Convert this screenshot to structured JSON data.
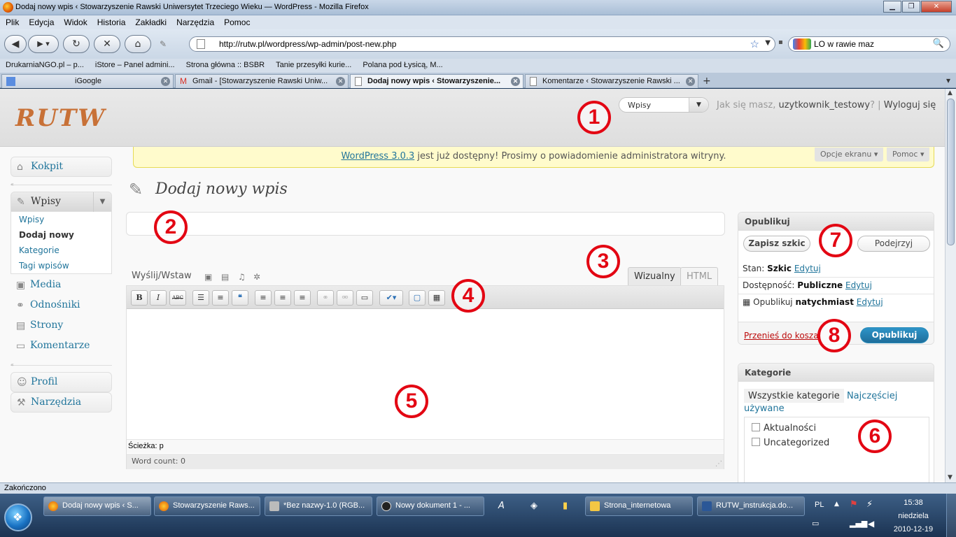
{
  "window": {
    "title": "Dodaj nowy wpis ‹ Stowarzyszenie Rawski Uniwersytet Trzeciego Wieku — WordPress - Mozilla Firefox"
  },
  "menubar": [
    "Plik",
    "Edycja",
    "Widok",
    "Historia",
    "Zakładki",
    "Narzędzia",
    "Pomoc"
  ],
  "navbar": {
    "url": "http://rutw.pl/wordpress/wp-admin/post-new.php",
    "search_value": "LO w rawie maz"
  },
  "bookmarks": [
    "DrukarniaNGO.pl – p...",
    "iStore – Panel admini...",
    "Strona główna :: BSBR",
    "Tanie przesyłki kurie...",
    "Polana pod Łysicą, M..."
  ],
  "tabs": [
    {
      "label": "iGoogle",
      "active": false
    },
    {
      "label": "Gmail - [Stowarzyszenie Rawski Uniw...",
      "active": false
    },
    {
      "label": "Dodaj nowy wpis ‹ Stowarzyszenie...",
      "active": true
    },
    {
      "label": "Komentarze ‹ Stowarzyszenie Rawski ...",
      "active": false
    }
  ],
  "wp": {
    "logo": "RUTW",
    "favorite_select": "Wpisy",
    "greeting_prefix": "Jak się masz,",
    "username": "uzytkownik_testowy",
    "greeting_suffix": "? |",
    "logout": "Wyloguj się",
    "nag_link": "WordPress 3.0.3",
    "nag_text": " jest już dostępny! Prosimy o powiadomienie administratora witryny.",
    "screen_options": "Opcje ekranu ▾",
    "help": "Pomoc ▾",
    "menu": {
      "kokpit": "Kokpit",
      "wpisy": "Wpisy",
      "submenu": [
        "Wpisy",
        "Dodaj nowy",
        "Kategorie",
        "Tagi wpisów"
      ],
      "media": "Media",
      "odnosniki": "Odnośniki",
      "strony": "Strony",
      "komentarze": "Komentarze",
      "profil": "Profil",
      "narzedzia": "Narzędzia"
    },
    "page_title": "Dodaj nowy wpis",
    "upload_label": "Wyślij/Wstaw",
    "tab_visual": "Wizualny",
    "tab_html": "HTML",
    "path_label": "Ścieżka: p",
    "word_count": "Word count: 0",
    "publish": {
      "heading": "Opublikuj",
      "save_draft": "Zapisz szkic",
      "preview": "Podejrzyj",
      "status_label": "Stan:",
      "status_value": "Szkic",
      "edit": "Edytuj",
      "visibility_label": "Dostępność:",
      "visibility_value": "Publiczne",
      "schedule_label": "Opublikuj",
      "schedule_value": "natychmiast",
      "trash": "Przenieś do kosza",
      "publish_btn": "Opublikuj"
    },
    "categories": {
      "heading": "Kategorie",
      "tab_all": "Wszystkie kategorie",
      "tab_popular": "Najczęściej używane",
      "items": [
        "Aktualności",
        "Uncategorized"
      ]
    }
  },
  "annotations": [
    "1",
    "2",
    "3",
    "4",
    "5",
    "6",
    "7",
    "8"
  ],
  "statusbar": "Zakończono",
  "taskbar": {
    "items": [
      "Dodaj nowy wpis ‹ S...",
      "Stowarzyszenie Raws...",
      "*Bez nazwy-1.0 (RGB...",
      "Nowy dokument 1 - ...",
      "Strona_internetowa",
      "RUTW_instrukcja.do..."
    ],
    "lang": "PL",
    "time": "15:38",
    "day": "niedziela",
    "date": "2010-12-19"
  },
  "colors": {
    "wp_link": "#21759b",
    "annotation": "#e30613",
    "logo": "#c87137",
    "publish_button": "#2e94c8"
  }
}
